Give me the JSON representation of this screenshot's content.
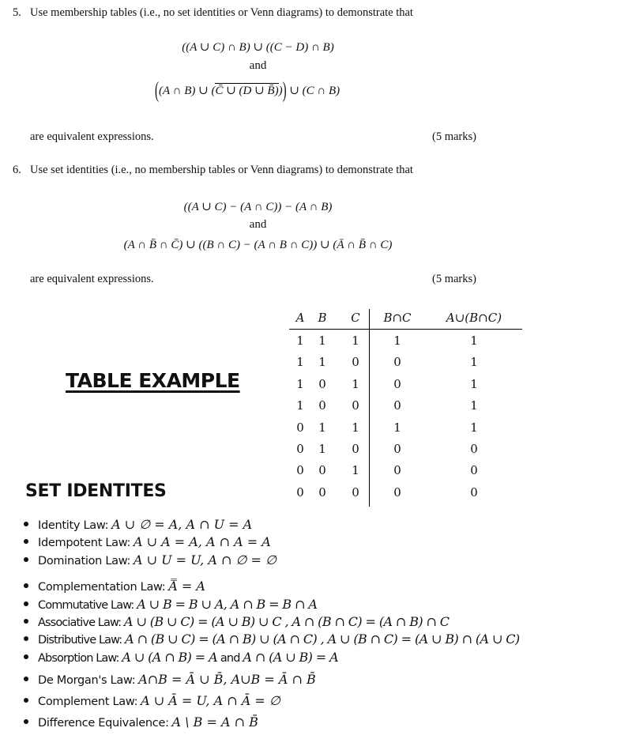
{
  "questions": [
    {
      "number": "5.",
      "prompt": "Use membership tables (i.e., no set identities or Venn diagrams) to demonstrate that",
      "expr1": "((A ∪ C) ∩ B) ∪ ((C − D) ∩ B)",
      "connector": "and",
      "expr2": {
        "part_a": "(A ∩ B) ∪ (",
        "overlined": "C̄ ∪ (D ∪ B̄)",
        "part_b": ")",
        "part_c": "∪ (C ∩ B)"
      },
      "conclusion": "are equivalent expressions.",
      "marks": "(5 marks)"
    },
    {
      "number": "6.",
      "prompt": "Use set identities (i.e., no membership tables or Venn diagrams) to demonstrate that",
      "expr1": "((A ∪ C) − (A ∩ C)) − (A ∩ B)",
      "connector": "and",
      "expr2": "(A ∩ B̄ ∩ C̄) ∪ ((B ∩ C) − (A ∩ B ∩ C)) ∪ (Ā ∩ B̄ ∩ C)",
      "conclusion": "are equivalent expressions.",
      "marks": "(5 marks)"
    }
  ],
  "table_example": {
    "title": "TABLE EXAMPLE",
    "headers": [
      "A",
      "B",
      "C",
      "B∩C",
      "A∪(B∩C)"
    ],
    "rows": [
      [
        "1",
        "1",
        "1",
        "1",
        "1"
      ],
      [
        "1",
        "1",
        "0",
        "0",
        "1"
      ],
      [
        "1",
        "0",
        "1",
        "0",
        "1"
      ],
      [
        "1",
        "0",
        "0",
        "0",
        "1"
      ],
      [
        "0",
        "1",
        "1",
        "1",
        "1"
      ],
      [
        "0",
        "1",
        "0",
        "0",
        "0"
      ],
      [
        "0",
        "0",
        "1",
        "0",
        "0"
      ],
      [
        "0",
        "0",
        "0",
        "0",
        "0"
      ]
    ]
  },
  "set_identities": {
    "title": "SET IDENTITES",
    "items": [
      {
        "label": "Identity Law:",
        "math": "A ∪ ∅ = A, A ∩ U = A"
      },
      {
        "label": "Idempotent Law:",
        "math": "A ∪ A = A, A ∩ A = A"
      },
      {
        "label": "Domination Law:",
        "math": "A ∪ U = U, A ∩ ∅ = ∅"
      },
      {
        "label": "Complementation Law:",
        "math": "A̿ = A"
      },
      {
        "label": "Commutative Law:",
        "math": "A ∪ B = B ∪ A, A ∩ B = B ∩ A"
      },
      {
        "label": "Associative Law:",
        "math": "A ∪ (B ∪ C) = (A ∪ B) ∪ C , A ∩ (B ∩ C) = (A ∩ B) ∩ C"
      },
      {
        "label": "Distributive Law:",
        "math": "A ∩ (B ∪ C) = (A ∩ B) ∪ (A ∩ C) , A ∪ (B ∩ C) = (A ∪ B) ∩ (A ∪ C)"
      },
      {
        "label": "Absorption Law:",
        "math": "A ∪ (A ∩ B) = A",
        "joiner": "and",
        "math2": "A ∩ (A ∪ B) = A"
      },
      {
        "label": "De Morgan's Law:",
        "math": "A∩B = Ā ∪ B̄, A∪B = Ā ∩ B̄"
      },
      {
        "label": "Complement Law:",
        "math": "A ∪ Ā = U, A ∩ Ā = ∅"
      },
      {
        "label": "Difference Equivalence:",
        "math": "A \\ B = A ∩ B̄"
      }
    ]
  }
}
